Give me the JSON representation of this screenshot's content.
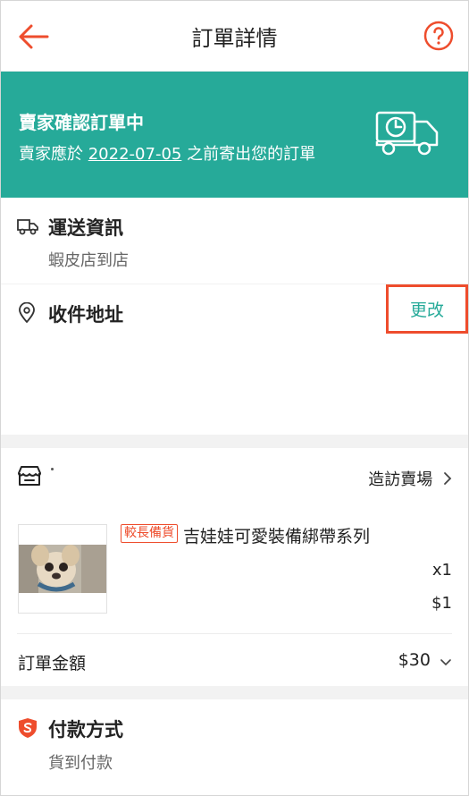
{
  "header": {
    "title": "訂單詳情",
    "back_icon": "back-arrow-icon",
    "help_icon": "help-circle-icon"
  },
  "banner": {
    "title": "賣家確認訂單中",
    "sub_before": "賣家應於 ",
    "sub_date": "2022-07-05",
    "sub_after": " 之前寄出您的訂單",
    "illustration_icon": "delivery-truck-clock-icon"
  },
  "shipping": {
    "title": "運送資訊",
    "method": "蝦皮店到店",
    "icon": "truck-icon"
  },
  "address": {
    "title": "收件地址",
    "change_label": "更改",
    "icon": "location-pin-icon"
  },
  "shop": {
    "visit_label": "造訪賣場",
    "icon": "store-icon",
    "product": {
      "badge": "較長備貨",
      "name": "吉娃娃可愛裝備綁帶系列",
      "qty": "x1",
      "price": "$1"
    },
    "total_label": "訂單金額",
    "total_value": "$30"
  },
  "payment": {
    "title": "付款方式",
    "method": "貨到付款",
    "icon": "shield-s-icon"
  },
  "colors": {
    "brand": "#ee4d2d",
    "teal": "#26aa99"
  }
}
